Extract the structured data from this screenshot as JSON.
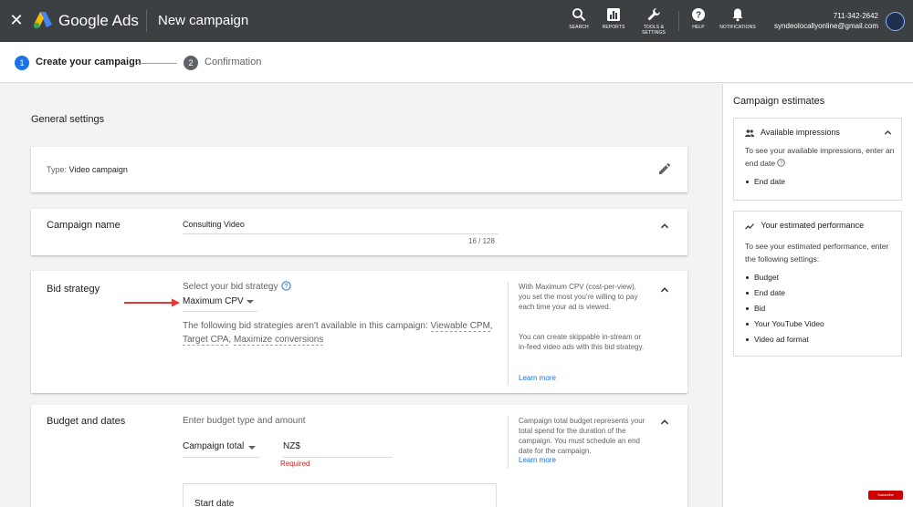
{
  "topbar": {
    "close_icon": "close-icon",
    "brand": "Google Ads",
    "page_title": "New campaign",
    "tools": [
      {
        "label": "SEARCH",
        "icon": "search-icon"
      },
      {
        "label": "REPORTS",
        "icon": "reports-icon"
      },
      {
        "label_line1": "TOOLS &",
        "label_line2": "SETTINGS",
        "icon": "wrench-icon"
      },
      {
        "label": "HELP",
        "icon": "help-icon"
      },
      {
        "label": "NOTIFICATIONS",
        "icon": "bell-icon"
      }
    ],
    "account_phone": "711-342-2642",
    "account_email": "syndeolocallyonline@gmail.com"
  },
  "stepper": {
    "steps": [
      {
        "number": "1",
        "label": "Create your campaign",
        "active": true
      },
      {
        "number": "2",
        "label": "Confirmation",
        "active": false
      }
    ]
  },
  "main": {
    "section_title": "General settings",
    "type_card": {
      "prefix": "Type:",
      "value": "Video campaign"
    },
    "name_card": {
      "label": "Campaign name",
      "value": "Consulting Video",
      "char_count": "16 / 128"
    },
    "bid_card": {
      "label": "Bid strategy",
      "select_label": "Select your bid strategy",
      "selected": "Maximum CPV",
      "note_prefix": "The following bid strategies aren't available in this campaign:",
      "unavailable": [
        "Viewable CPM",
        "Target CPA",
        "Maximize conversions"
      ],
      "side_text_1": "With Maximum CPV (cost-per-view), you set the most you're willing to pay each time your ad is viewed.",
      "side_text_2": "You can create skippable in-stream or in-feed video ads with this bid strategy.",
      "learn_more": "Learn more"
    },
    "budget_card": {
      "label": "Budget and dates",
      "instruction": "Enter budget type and amount",
      "budget_type": "Campaign total",
      "currency": "NZ$",
      "required": "Required",
      "side_text": "Campaign total budget represents your total spend for the duration of the campaign. You must schedule an end date for the campaign.",
      "learn_more": "Learn more",
      "start_date_label": "Start date"
    }
  },
  "estimates": {
    "title": "Campaign estimates",
    "impressions": {
      "heading": "Available impressions",
      "body": "To see your available impressions, enter an end date",
      "items": [
        "End date"
      ]
    },
    "performance": {
      "heading": "Your estimated performance",
      "body": "To see your estimated performance, enter the following settings:",
      "items": [
        "Budget",
        "End date",
        "Bid",
        "Your YouTube Video",
        "Video ad format"
      ]
    }
  },
  "overlay": {
    "subscribe": "Subscribe"
  },
  "colors": {
    "topbar_bg": "#3c4043",
    "accent_blue": "#1a73e8",
    "error_red": "#c5221f",
    "annotation_arrow": "#e53935"
  }
}
